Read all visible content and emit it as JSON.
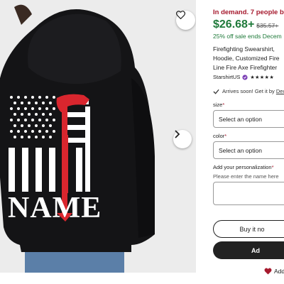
{
  "listing": {
    "demand_text": "In demand. 7 people bou",
    "price": "$26.68+",
    "original_price": "$35.57+",
    "sale_text": "25% off sale ends Decem",
    "title_lines": [
      "Firefighting Swearshirt,",
      "Hoodie, Customized Fire",
      "Line Fire Axe Firefighter"
    ],
    "shop_name": "StarshirtUS",
    "rating_stars": "★★★★★",
    "arrival_text": "Arrives soon! Get it by ",
    "arrival_link": "Dec",
    "accent_color": "#1f7a3a",
    "alert_color": "#a61a2e"
  },
  "options": {
    "size_label": "size",
    "size_value": "Select an option",
    "color_label": "color",
    "color_value": "Select an option",
    "personalization_label": "Add your personalization",
    "personalization_hint": "Please enter the name here",
    "required_mark": "*"
  },
  "actions": {
    "buy_now": "Buy it no",
    "add_to_cart": "Ad",
    "add_to_favorites": "Add"
  },
  "photo": {
    "print_text": "NAME",
    "icons": [
      "heart-icon",
      "chevron-right-icon"
    ]
  }
}
